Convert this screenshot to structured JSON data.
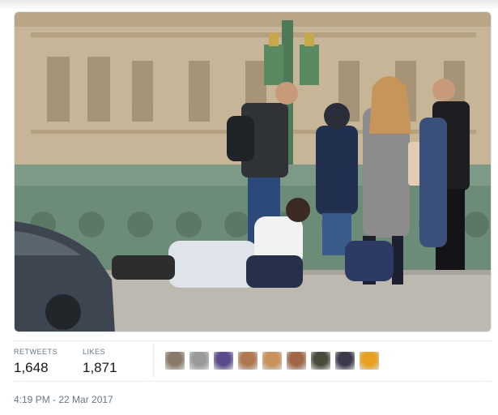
{
  "tweet": {
    "stats": {
      "retweets_label": "RETWEETS",
      "retweets_value": "1,648",
      "likes_label": "LIKES",
      "likes_value": "1,871"
    },
    "timestamp": "4:19 PM - 22 Mar 2017",
    "likers": [
      {
        "name": "liker-avatar-1",
        "color": "#8a7a6a"
      },
      {
        "name": "liker-avatar-2",
        "color": "#9a9a9a"
      },
      {
        "name": "liker-avatar-3",
        "color": "#5b4a8a"
      },
      {
        "name": "liker-avatar-4",
        "color": "#b07850"
      },
      {
        "name": "liker-avatar-5",
        "color": "#c8905a"
      },
      {
        "name": "liker-avatar-6",
        "color": "#a06848"
      },
      {
        "name": "liker-avatar-7",
        "color": "#4a4a3a"
      },
      {
        "name": "liker-avatar-8",
        "color": "#3a3a4a"
      },
      {
        "name": "liker-avatar-9",
        "color": "#e8a020"
      }
    ]
  }
}
